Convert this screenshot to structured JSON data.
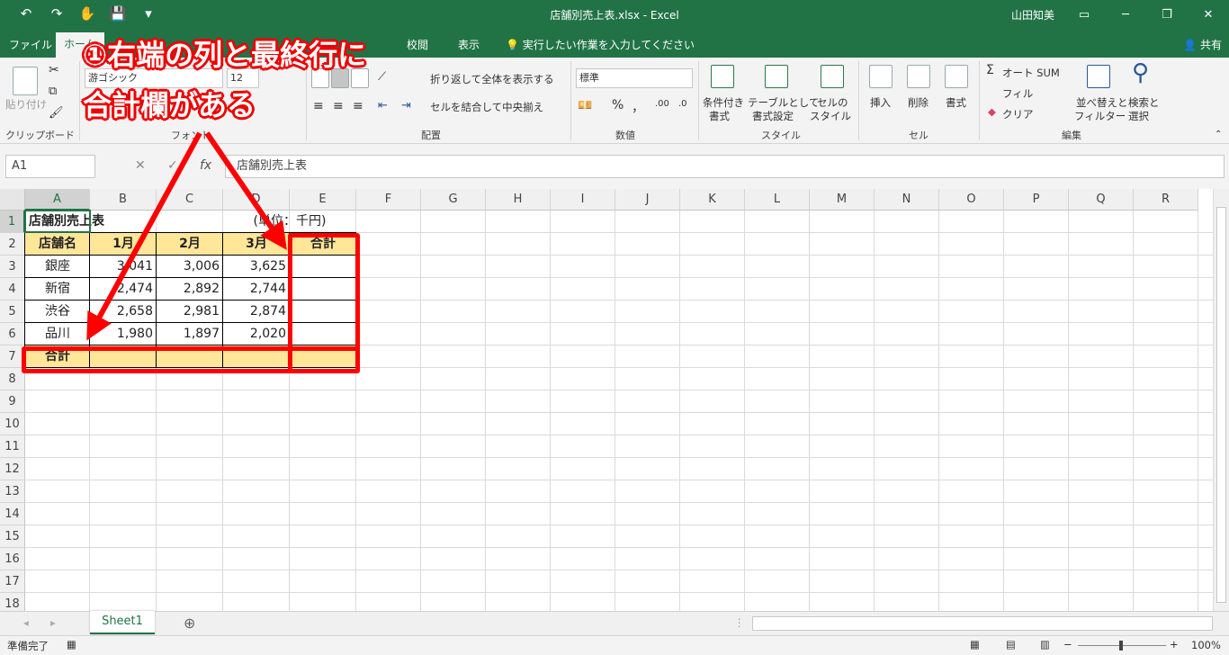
{
  "titlebar": {
    "title": "店舗別売上表.xlsx  -  Excel",
    "user": "山田知美",
    "qat": [
      "↶",
      "↷",
      "✋",
      "💾",
      "▾"
    ],
    "win_buttons": [
      "▭",
      "─",
      "❐",
      "✕"
    ]
  },
  "tabs": [
    {
      "label": "ファイル",
      "active": false
    },
    {
      "label": "ホーム",
      "active": true
    },
    {
      "label": "校閲",
      "active": false
    },
    {
      "label": "表示",
      "active": false
    }
  ],
  "tellme": "💡 実行したい作業を入力してください",
  "share": "👤 共有",
  "ribbon": {
    "clipboard": {
      "paste": "貼り付け",
      "label": "クリップボード"
    },
    "font": {
      "name": "游ゴシック",
      "size": "12",
      "label": "フォント"
    },
    "alignment": {
      "wrap": "折り返して全体を表示する",
      "merge": "セルを結合して中央揃え",
      "label": "配置"
    },
    "number": {
      "format": "標準",
      "percent": "%",
      "comma": "，",
      "label": "数値"
    },
    "styles": {
      "conditional": [
        "条件付き",
        "書式"
      ],
      "table": [
        "テーブルとして",
        "書式設定"
      ],
      "cell": [
        "セルの",
        "スタイル"
      ],
      "label": "スタイル"
    },
    "cells": {
      "insert": "挿入",
      "delete": "削除",
      "format": "書式",
      "label": "セル"
    },
    "editing": {
      "autosum": "オート SUM",
      "fill": "フィル",
      "clear": "クリア",
      "sort": [
        "並べ替えと",
        "フィルター"
      ],
      "find": [
        "検索と",
        "選択"
      ],
      "label": "編集"
    }
  },
  "formula_bar": {
    "name_box": "A1",
    "fx": "fx",
    "cancel": "✕",
    "enter": "✓",
    "content": "店舗別売上表"
  },
  "grid": {
    "columns": [
      "A",
      "B",
      "C",
      "D",
      "E",
      "F",
      "G",
      "H",
      "I",
      "J",
      "K",
      "L",
      "M",
      "N",
      "O",
      "P",
      "Q",
      "R"
    ],
    "rows": [
      "1",
      "2",
      "3",
      "4",
      "5",
      "6",
      "7",
      "8",
      "9",
      "10",
      "11",
      "12",
      "13",
      "14",
      "15",
      "16",
      "17",
      "18"
    ]
  },
  "sheet": {
    "title": "店舗別売上表",
    "unit": "(単位：千円)",
    "headers": [
      "店舗名",
      "1月",
      "2月",
      "3月",
      "合計"
    ],
    "rows": [
      {
        "store": "銀座",
        "m1": "3,041",
        "m2": "3,006",
        "m3": "3,625"
      },
      {
        "store": "新宿",
        "m1": "2,474",
        "m2": "2,892",
        "m3": "2,744"
      },
      {
        "store": "渋谷",
        "m1": "2,658",
        "m2": "2,981",
        "m3": "2,874"
      },
      {
        "store": "品川",
        "m1": "1,980",
        "m2": "1,897",
        "m3": "2,020"
      }
    ],
    "total_label": "合計"
  },
  "sheet_tabs": {
    "active": "Sheet1",
    "add": "⊕"
  },
  "status": {
    "ready": "準備完了",
    "zoom": "100%"
  },
  "annotation": {
    "line1": "①右端の列と最終行に",
    "line2": "合計欄がある",
    "color": "#ff0000"
  }
}
